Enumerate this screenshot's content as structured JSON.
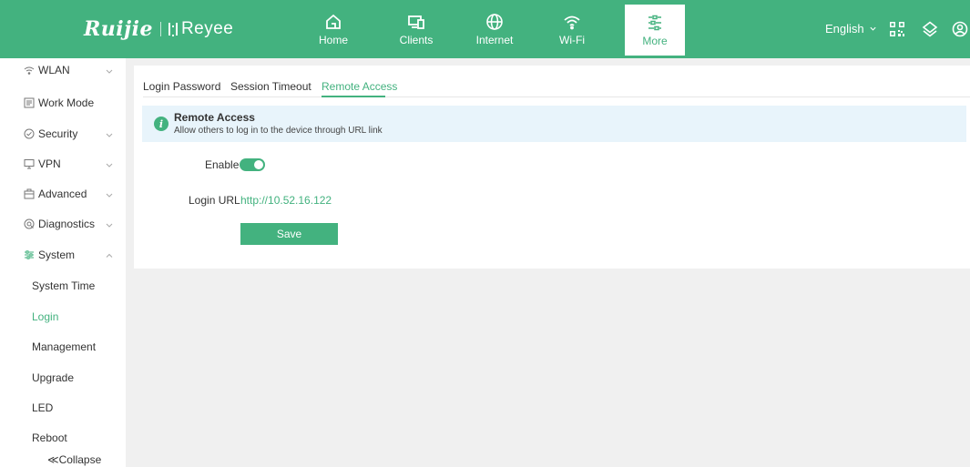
{
  "brand": {
    "name": "Ruijie",
    "sub": "Reyee"
  },
  "nav": [
    {
      "label": "Home",
      "icon": "home-icon"
    },
    {
      "label": "Clients",
      "icon": "clients-icon"
    },
    {
      "label": "Internet",
      "icon": "globe-icon"
    },
    {
      "label": "Wi-Fi",
      "icon": "wifi-icon"
    },
    {
      "label": "More",
      "icon": "more-icon",
      "active": true
    }
  ],
  "header": {
    "language": "English"
  },
  "sidebar": {
    "items": [
      {
        "label": "WLAN",
        "icon": "wifi-icon",
        "expandable": true
      },
      {
        "label": "Work Mode",
        "icon": "workmode-icon",
        "expandable": false
      },
      {
        "label": "Security",
        "icon": "shield-icon",
        "expandable": true
      },
      {
        "label": "VPN",
        "icon": "vpn-icon",
        "expandable": true
      },
      {
        "label": "Advanced",
        "icon": "advanced-icon",
        "expandable": true
      },
      {
        "label": "Diagnostics",
        "icon": "diagnostics-icon",
        "expandable": true
      },
      {
        "label": "System",
        "icon": "system-icon",
        "expandable": true,
        "expanded": true
      }
    ],
    "system_sub": [
      "System Time",
      "Login",
      "Management",
      "Upgrade",
      "LED",
      "Reboot"
    ],
    "active_sub": "Login",
    "collapse": "≪Collapse"
  },
  "tabs": [
    "Login Password",
    "Session Timeout",
    "Remote Access"
  ],
  "active_tab": "Remote Access",
  "notice": {
    "title": "Remote Access",
    "description": "Allow others to log in to the device through URL link"
  },
  "form": {
    "enable_label": "Enable",
    "enable_value": true,
    "url_label": "Login URL",
    "url_value": "http://10.52.16.122",
    "save_label": "Save"
  },
  "colors": {
    "accent": "#43b27f",
    "notice_bg": "#e8f4fb",
    "page_bg": "#f0f0f0"
  }
}
